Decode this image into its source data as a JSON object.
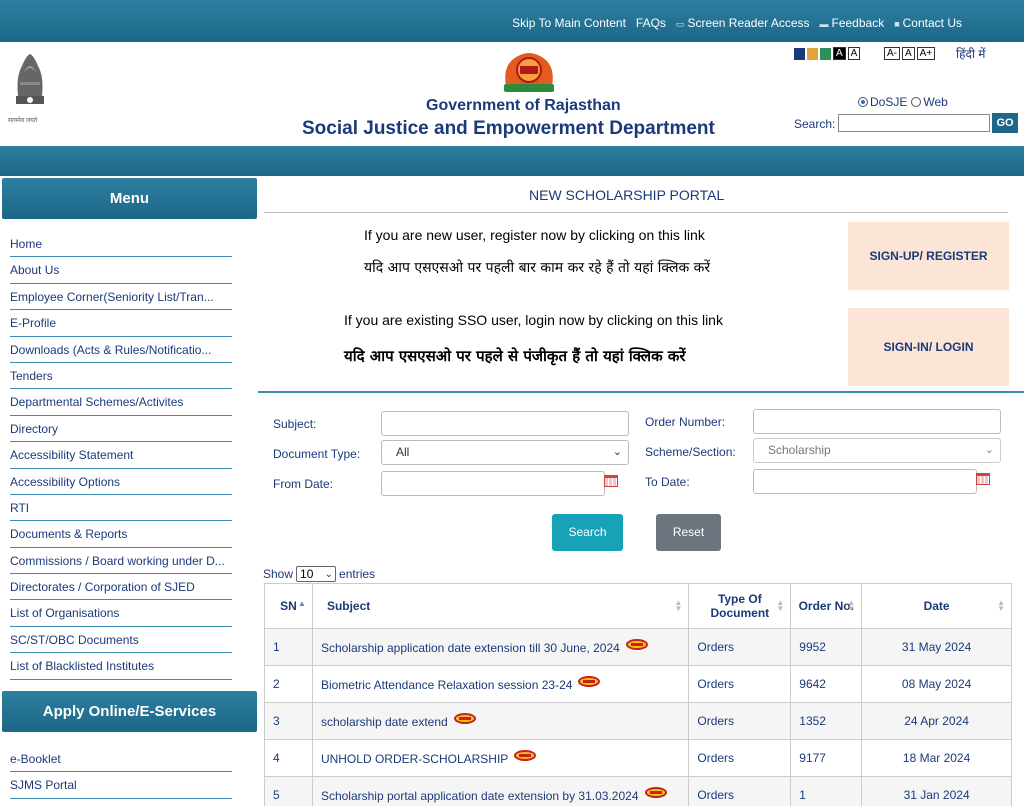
{
  "top_links": [
    {
      "label": "Skip To Main Content",
      "icon": ""
    },
    {
      "label": "FAQs",
      "icon": ""
    },
    {
      "label": "Screen Reader Access",
      "icon": "screen-reader-icon"
    },
    {
      "label": "Feedback",
      "icon": "feedback-icon"
    },
    {
      "label": "Contact Us",
      "icon": "contact-icon"
    }
  ],
  "header": {
    "emblem_caption": "सत्यमेव जयते",
    "gov_title": "Government of Rajasthan",
    "dept_title": "Social Justice and Empowerment Department",
    "font_buttons": [
      "A-",
      "A",
      "A+"
    ],
    "contrast_label": "A",
    "contrast_label_light": "A",
    "hindi_link": "हिंदी में",
    "swatch_colors": [
      "#1b3a7a",
      "#e0a63c",
      "#2f8f5b",
      "#000000"
    ],
    "radio_options": [
      {
        "label": "DoSJE",
        "checked": true
      },
      {
        "label": "Web",
        "checked": false
      }
    ],
    "search_label": "Search:",
    "search_value": "",
    "go_label": "GO"
  },
  "sidebar": {
    "menu_title": "Menu",
    "menu_items": [
      "Home",
      "About Us",
      "Employee Corner(Seniority List/Tran...",
      "E-Profile",
      "Downloads (Acts & Rules/Notificatio...",
      "Tenders",
      "Departmental Schemes/Activites",
      "Directory",
      "Accessibility Statement",
      "Accessibility Options",
      "RTI",
      "Documents & Reports",
      "Commissions / Board working under D...",
      "Directorates / Corporation of SJED",
      "List of Organisations",
      "SC/ST/OBC Documents",
      "List of Blacklisted Institutes"
    ],
    "apply_title": "Apply Online/E-Services",
    "eservice_items": [
      "e-Booklet",
      "SJMS Portal"
    ]
  },
  "main": {
    "portal_title": "NEW SCHOLARSHIP PORTAL",
    "register_text_en": "If you are new user, register now by clicking on this link",
    "register_text_hi": "यदि आप एसएसओ पर पहली बार काम कर रहे हैं तो यहां क्लिक करें",
    "register_button": "SIGN-UP/ REGISTER",
    "login_text_en": "If you are existing SSO user, login now by clicking on this link",
    "login_text_hi": "यदि आप एसएसओ पर पहले से पंजीकृत हैं तो यहां क्लिक करें",
    "login_button": "SIGN-IN/ LOGIN"
  },
  "filters": {
    "subject_label": "Subject:",
    "subject_value": "",
    "order_number_label": "Order Number:",
    "order_number_value": "",
    "doc_type_label": "Document Type:",
    "doc_type_value": "All",
    "scheme_label": "Scheme/Section:",
    "scheme_value": "Scholarship",
    "from_date_label": "From Date:",
    "from_date_value": "",
    "to_date_label": "To Date:",
    "to_date_value": "",
    "search_button": "Search",
    "reset_button": "Reset"
  },
  "table": {
    "show_label": "Show",
    "entries_value": "10",
    "entries_label": "entries",
    "columns": [
      "SN",
      "Subject",
      "Type Of Document",
      "Order No.",
      "Date"
    ],
    "rows": [
      {
        "sn": "1",
        "subject": "Scholarship application date extension till 30 June, 2024",
        "type": "Orders",
        "order_no": "9952",
        "date": "31 May 2024"
      },
      {
        "sn": "2",
        "subject": "Biometric Attendance Relaxation session 23-24",
        "type": "Orders",
        "order_no": "9642",
        "date": "08 May 2024"
      },
      {
        "sn": "3",
        "subject": "scholarship date extend",
        "type": "Orders",
        "order_no": "1352",
        "date": "24 Apr 2024"
      },
      {
        "sn": "4",
        "subject": "UNHOLD ORDER-SCHOLARSHIP",
        "type": "Orders",
        "order_no": "9177",
        "date": "18 Mar 2024"
      },
      {
        "sn": "5",
        "subject": "Scholarship portal application date extension by 31.03.2024",
        "type": "Orders",
        "order_no": "1",
        "date": "31 Jan 2024"
      }
    ]
  }
}
